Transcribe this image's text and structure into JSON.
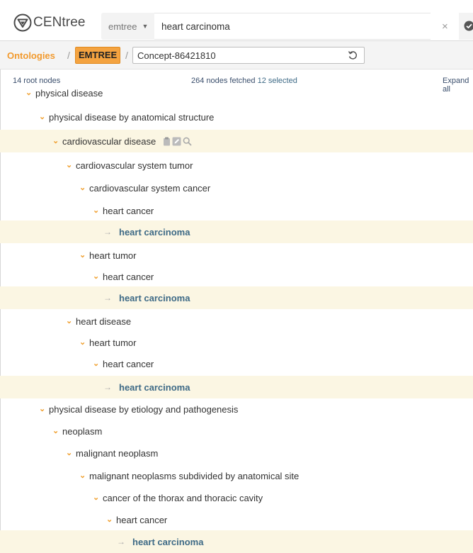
{
  "header": {
    "logo_text": "CENtree",
    "ontology_select": "emtree",
    "search_value": "heart carcinoma",
    "clear_symbol": "×"
  },
  "breadcrumb": {
    "ontologies": "Ontologies",
    "sep": "/",
    "ontology": "EMTREE",
    "concept": "Concept-86421810"
  },
  "status": {
    "root_nodes": "14 root nodes",
    "fetched_prefix": "264 nodes fetched ",
    "selected": "12 selected",
    "expand_all": "Expand all"
  },
  "tree": [
    {
      "label": "physical disease",
      "level": 0,
      "type": "branch",
      "highlight": false
    },
    {
      "label": "physical disease by anatomical structure",
      "level": 1,
      "type": "branch",
      "highlight": false
    },
    {
      "label": "cardiovascular disease",
      "level": 2,
      "type": "branch",
      "highlight": true,
      "tools": true
    },
    {
      "label": "cardiovascular system tumor",
      "level": 3,
      "type": "branch",
      "highlight": false
    },
    {
      "label": "cardiovascular system cancer",
      "level": 4,
      "type": "branch",
      "highlight": false
    },
    {
      "label": "heart cancer",
      "level": 5,
      "type": "branch",
      "highlight": false
    },
    {
      "label": "heart carcinoma",
      "level": 6,
      "type": "leaf",
      "highlight": true
    },
    {
      "label": "heart tumor",
      "level": 4,
      "type": "branch",
      "highlight": false
    },
    {
      "label": "heart cancer",
      "level": 5,
      "type": "branch",
      "highlight": false
    },
    {
      "label": "heart carcinoma",
      "level": 6,
      "type": "leaf",
      "highlight": true
    },
    {
      "label": "heart disease",
      "level": 3,
      "type": "branch",
      "highlight": false
    },
    {
      "label": "heart tumor",
      "level": 4,
      "type": "branch",
      "highlight": false
    },
    {
      "label": "heart cancer",
      "level": 5,
      "type": "branch",
      "highlight": false
    },
    {
      "label": "heart carcinoma",
      "level": 6,
      "type": "leaf",
      "highlight": true
    },
    {
      "label": "physical disease by etiology and pathogenesis",
      "level": 1,
      "type": "branch",
      "highlight": false
    },
    {
      "label": "neoplasm",
      "level": 2,
      "type": "branch",
      "highlight": false
    },
    {
      "label": "malignant neoplasm",
      "level": 3,
      "type": "branch",
      "highlight": false
    },
    {
      "label": "malignant neoplasms subdivided by anatomical site",
      "level": 4,
      "type": "branch",
      "highlight": false
    },
    {
      "label": "cancer of the thorax and thoracic cavity",
      "level": 5,
      "type": "branch",
      "highlight": false
    },
    {
      "label": "heart cancer",
      "level": 6,
      "type": "branch",
      "highlight": false
    },
    {
      "label": "heart carcinoma",
      "level": 7,
      "type": "leaf",
      "highlight": true
    }
  ],
  "colors": {
    "accent": "#f29a2e",
    "highlight_row": "#fbf6e3",
    "leaf_text": "#3e6a86"
  }
}
